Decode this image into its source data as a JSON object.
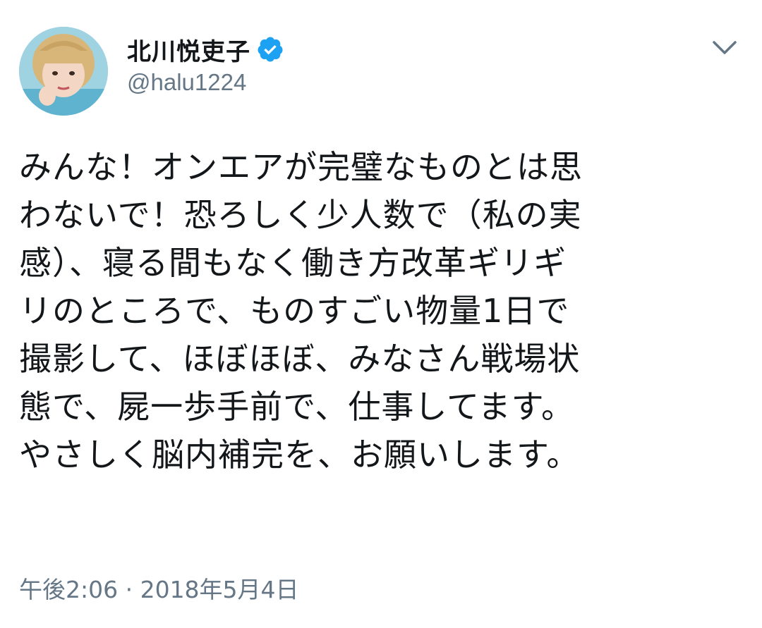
{
  "tweet": {
    "author": {
      "display_name": "北川悦吏子",
      "handle": "@halu1224",
      "verified_icon": "verified-badge-icon",
      "avatar": "avatar"
    },
    "menu_icon": "chevron-down-icon",
    "text": "みんな！オンエアが完璧なものとは思\nわないで！恐ろしく少人数で（私の実\n感）、寝る間もなく働き方改革ギリギ\nリのところで、ものすごい物量1日で\n撮影して、ほぼほぼ、みなさん戦場状\n態で、屍一歩手前で、仕事してます。\nやさしく脳内補完を、お願いします。",
    "timestamp": "午後2:06 · 2018年5月4日"
  },
  "colors": {
    "verified": "#1da1f2",
    "secondary_text": "#657786",
    "primary_text": "#14171a"
  }
}
